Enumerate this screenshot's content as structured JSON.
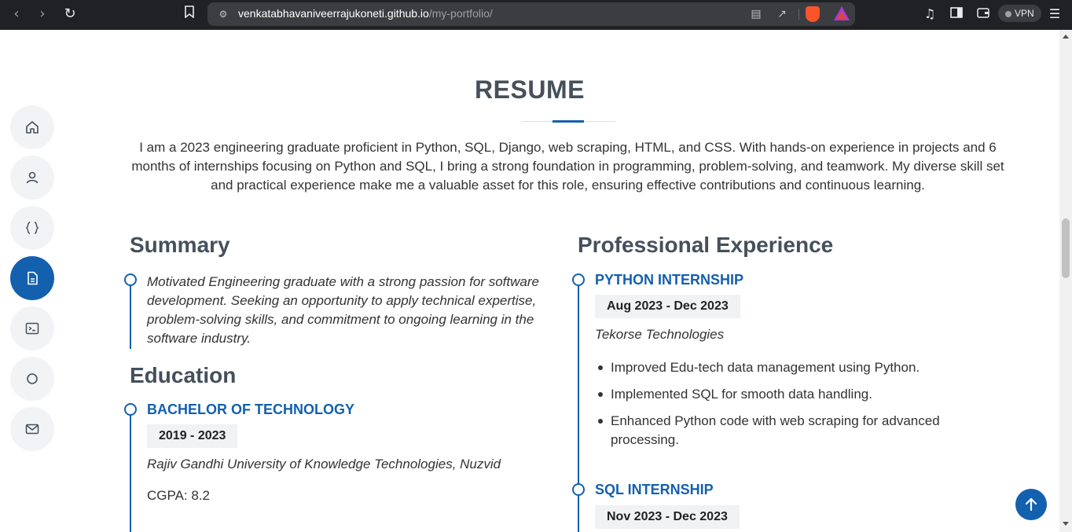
{
  "browser": {
    "url_host": "venkatabhavaniveerrajukoneti.github.io",
    "url_path": "/my-portfolio/",
    "vpn_label": "VPN"
  },
  "sidenav": {
    "items": [
      {
        "name": "home",
        "icon": "home-icon"
      },
      {
        "name": "about",
        "icon": "person-icon"
      },
      {
        "name": "skills",
        "icon": "braces-icon"
      },
      {
        "name": "resume",
        "icon": "file-icon",
        "active": true
      },
      {
        "name": "projects",
        "icon": "terminal-icon"
      },
      {
        "name": "services",
        "icon": "circle-icon"
      },
      {
        "name": "contact",
        "icon": "envelope-icon"
      }
    ]
  },
  "resume": {
    "title": "RESUME",
    "intro": "I am a 2023 engineering graduate proficient in Python, SQL, Django, web scraping, HTML, and CSS. With hands-on experience in projects and 6 months of internships focusing on Python and SQL, I bring a strong foundation in programming, problem-solving, and teamwork. My diverse skill set and practical experience make me a valuable asset for this role, ensuring effective contributions and continuous learning.",
    "summary": {
      "heading": "Summary",
      "text": "Motivated Engineering graduate with a strong passion for software development. Seeking an opportunity to apply technical expertise, problem-solving skills, and commitment to ongoing learning in the software industry."
    },
    "education": {
      "heading": "Education",
      "degree": "BACHELOR OF TECHNOLOGY",
      "years": "2019 - 2023",
      "institution": "Rajiv Gandhi University of Knowledge Technologies, Nuzvid",
      "cgpa": "CGPA: 8.2"
    },
    "experience": {
      "heading": "Professional Experience",
      "jobs": [
        {
          "title": "PYTHON INTERNSHIP",
          "dates": "Aug 2023 - Dec 2023",
          "company": "Tekorse Technologies",
          "bullets": [
            "Improved Edu-tech data management using Python.",
            "Implemented SQL for smooth data handling.",
            "Enhanced Python code with web scraping for advanced processing."
          ]
        },
        {
          "title": "SQL INTERNSHIP",
          "dates": "Nov 2023 - Dec 2023"
        }
      ]
    }
  },
  "colors": {
    "accent": "#1360ae",
    "heading": "#45505b",
    "chrome": "#202124"
  }
}
